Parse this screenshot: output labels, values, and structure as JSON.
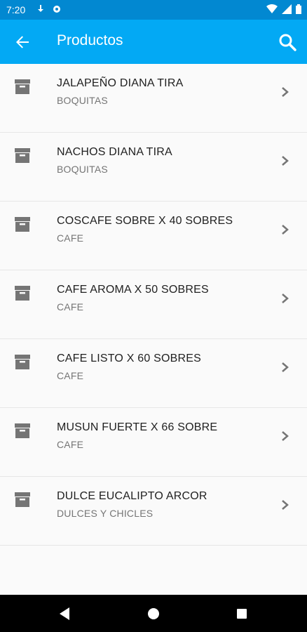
{
  "status_bar": {
    "time": "7:20",
    "icons": [
      "download-icon",
      "settings-icon",
      "wifi-icon",
      "signal-icon",
      "battery-icon"
    ]
  },
  "app_bar": {
    "title": "Productos",
    "back_icon": "arrow-back-icon",
    "search_icon": "search-icon",
    "color": "#03a9f4",
    "status_color": "#0288d1"
  },
  "products": [
    {
      "name": "JALAPEÑO DIANA TIRA",
      "category": "BOQUITAS"
    },
    {
      "name": "NACHOS DIANA TIRA",
      "category": "BOQUITAS"
    },
    {
      "name": "COSCAFE SOBRE X 40 SOBRES",
      "category": "CAFE"
    },
    {
      "name": "CAFE AROMA X 50 SOBRES",
      "category": "CAFE"
    },
    {
      "name": "CAFE LISTO X 60 SOBRES",
      "category": "CAFE"
    },
    {
      "name": "MUSUN FUERTE X 66 SOBRE",
      "category": "CAFE"
    },
    {
      "name": "DULCE EUCALIPTO ARCOR",
      "category": "DULCES Y CHICLES"
    }
  ],
  "nav_bar": {
    "buttons": [
      "back-triangle-icon",
      "home-circle-icon",
      "recents-square-icon"
    ]
  }
}
